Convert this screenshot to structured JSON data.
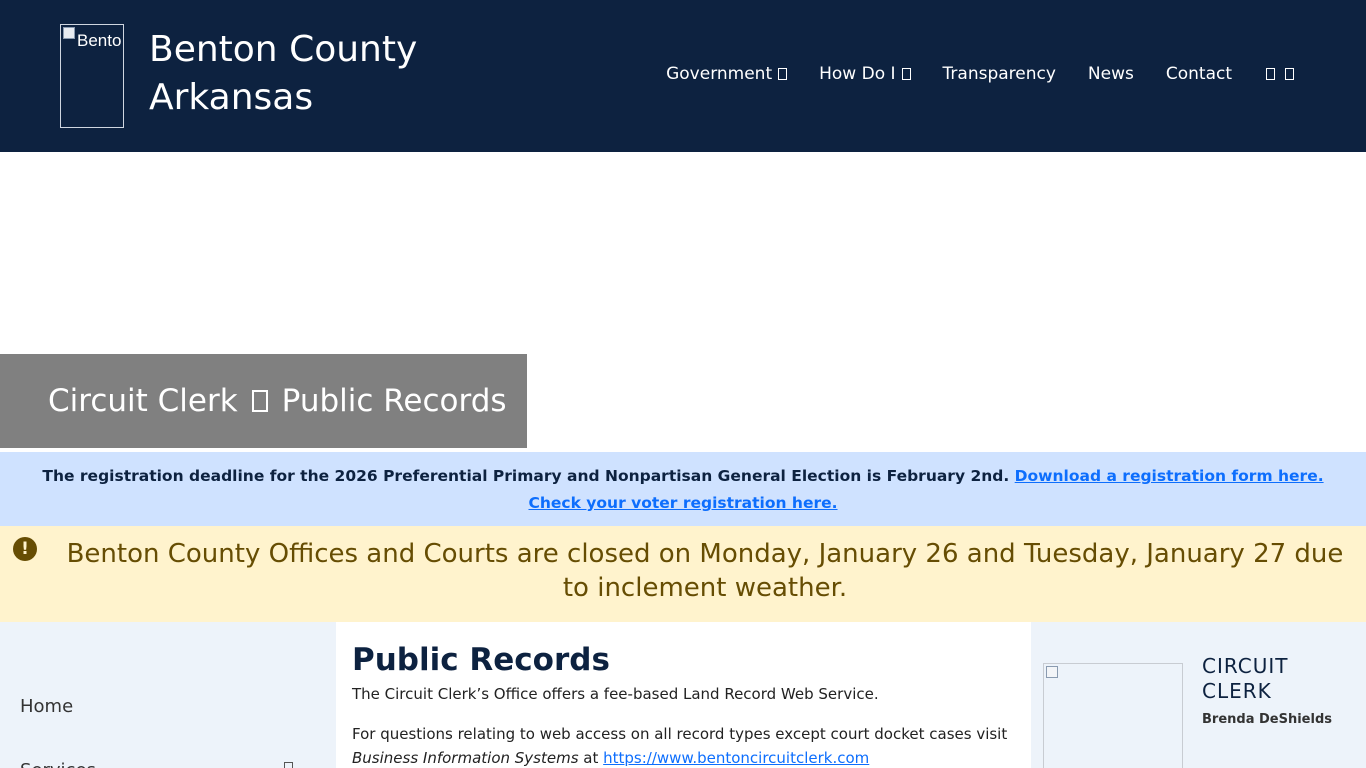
{
  "header": {
    "logo_alt": "Bento",
    "site_name": "Benton County Arkansas",
    "nav": [
      "Government",
      "How Do I",
      "Transparency",
      "News",
      "Contact"
    ]
  },
  "page_title": {
    "left": "Circuit Clerk",
    "right": "Public Records"
  },
  "info_banner": {
    "text": "The registration deadline for the 2026 Preferential Primary and Nonpartisan General Election is February 2nd.",
    "link1": "Download a registration form here.",
    "link2": "Check your voter registration here."
  },
  "alert": {
    "icon": "!",
    "text": "Benton County Offices and Courts are closed on Monday, January 26 and Tuesday, January 27 due to inclement weather."
  },
  "sidebar": {
    "home": "Home",
    "second": "Services"
  },
  "content": {
    "heading": "Public Records",
    "p1": "The Circuit Clerk’s Office offers a fee-based Land Record Web Service.",
    "p2_text": "For questions relating to web access on all record types except court docket cases visit",
    "p2_em": "Business Information Systems",
    "p2_at": " at ",
    "p2_link": "https://www.bentoncircuitclerk.com"
  },
  "office": {
    "title": "CIRCUIT CLERK",
    "name": "Brenda DeShields"
  }
}
